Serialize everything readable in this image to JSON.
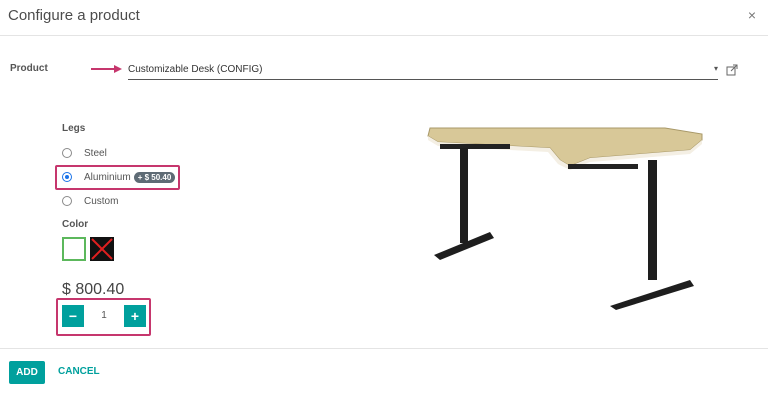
{
  "dialog": {
    "title": "Configure a product",
    "close_icon": "×"
  },
  "product": {
    "label": "Product",
    "value": "Customizable Desk (CONFIG)",
    "caret_icon": "▾"
  },
  "legs": {
    "label": "Legs",
    "options": [
      {
        "label": "Steel",
        "checked": false
      },
      {
        "label": "Aluminium",
        "checked": true,
        "badge": "+ $ 50.40"
      },
      {
        "label": "Custom",
        "checked": false
      }
    ]
  },
  "color": {
    "label": "Color",
    "options": [
      {
        "name": "white",
        "selected": true
      },
      {
        "name": "black",
        "selected": false,
        "unavailable": true
      }
    ]
  },
  "price": "$ 800.40",
  "quantity": {
    "minus": "−",
    "value": "1",
    "plus": "+"
  },
  "footer": {
    "add_label": "ADD",
    "cancel_label": "CANCEL"
  },
  "colors": {
    "primary": "#00a09d",
    "highlight": "#c6366d",
    "radio_checked": "#1a73e8",
    "badge": "#5e6b75"
  }
}
